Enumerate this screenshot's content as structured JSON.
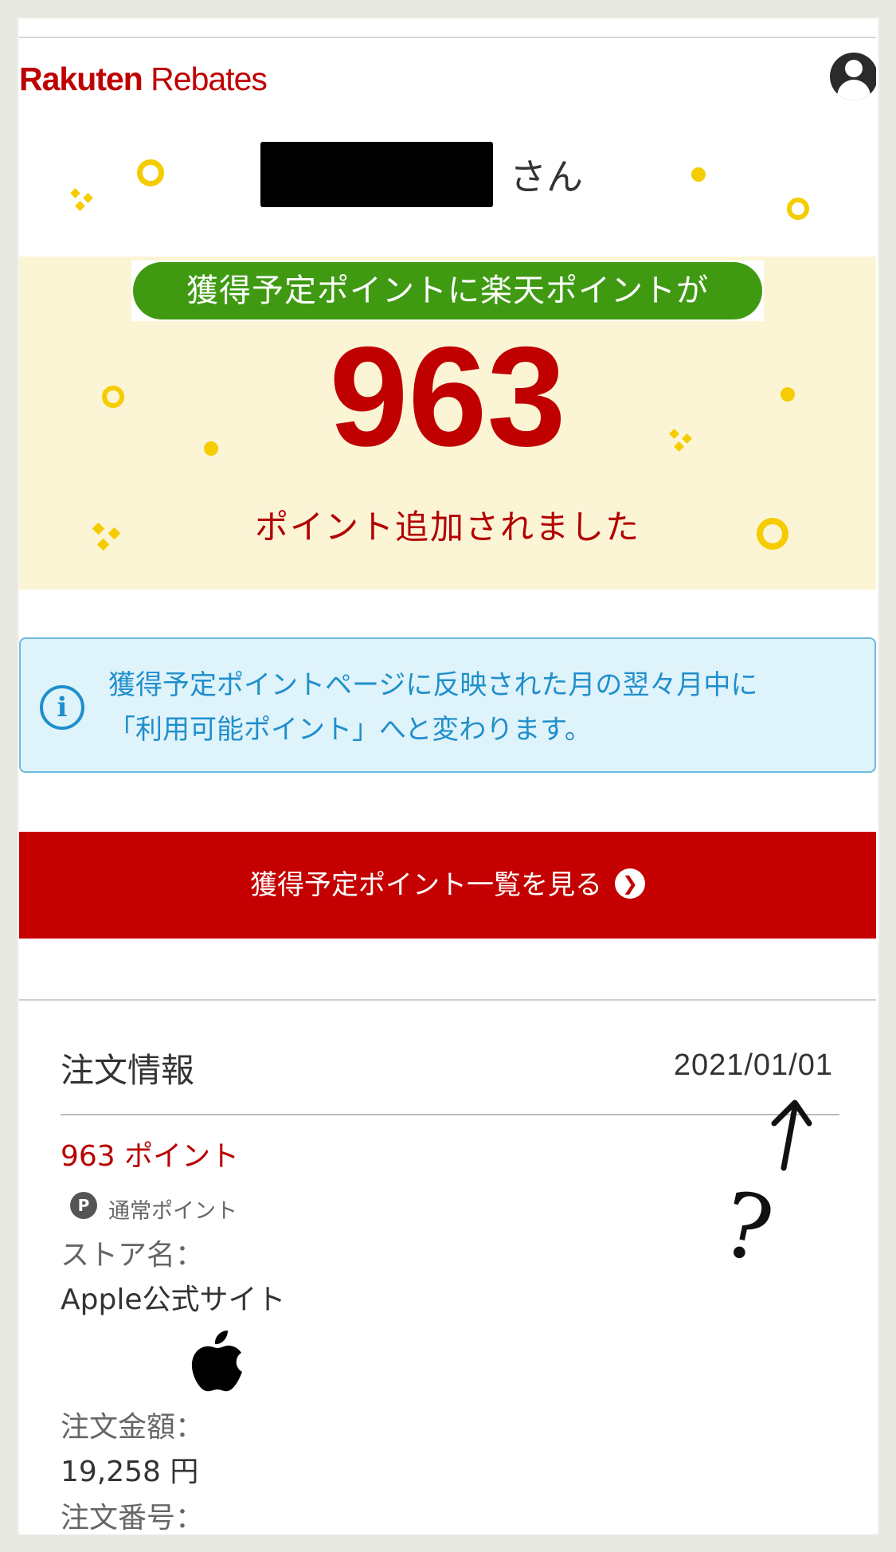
{
  "header": {
    "logo_rakuten": "Rakuten",
    "logo_rebates": " Rebates",
    "avatar_icon": "account-circle-icon"
  },
  "greeting": {
    "name_redacted": "",
    "suffix": "さん"
  },
  "points_banner": {
    "headline": "獲得予定ポイントに楽天ポイントが",
    "points": "963",
    "message": "ポイント追加されました",
    "accent_color": "#c00000",
    "pill_color": "#3f9a12"
  },
  "info_notice": {
    "icon": "info-icon",
    "line1": "獲得予定ポイントページに反映された月の翌々月中に",
    "line2": "「利用可能ポイント」へと変わります。"
  },
  "cta": {
    "label": "獲得予定ポイント一覧を見る",
    "icon": "chevron-right-circle-icon"
  },
  "order": {
    "section_title": "注文情報",
    "date": "2021/01/01",
    "points": "963 ポイント",
    "point_type_badge": "P",
    "point_type": "通常ポイント",
    "store_label": "ストア名：",
    "store_name": "Apple公式サイト",
    "store_logo": "apple-logo",
    "amount_label": "注文金額：",
    "amount": "19,258 円",
    "order_number_label": "注文番号："
  },
  "annotation": {
    "question_mark": "?"
  }
}
